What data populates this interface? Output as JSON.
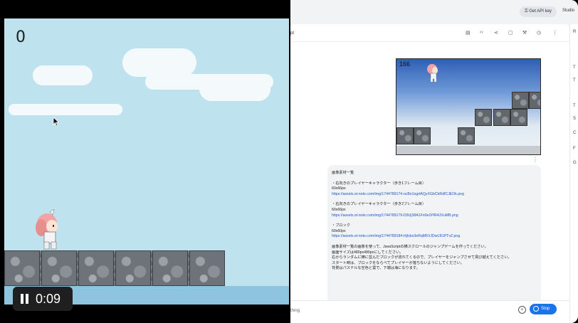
{
  "game": {
    "score": "0",
    "timer": "0:09"
  },
  "studio": {
    "api_key_label": "Get API key",
    "studio_label": "Studio",
    "prompt_title": "pt",
    "side_labels": [
      "R",
      "T",
      "T",
      "T",
      "S",
      "C",
      "F",
      "G"
    ],
    "preview_score": "166",
    "message": {
      "heading": "画像素材一覧",
      "items": [
        {
          "name": "・右向きのプレイヤーキャラクター（歩き1フレーム目）",
          "size": "60x66px",
          "url": "https://assets.st-note.com/img/1744789174-ocBx1ogrtAQyXGbCbRdfCJEOk.png"
        },
        {
          "name": "・右向きのプレイヤーキャラクター（歩き2フレーム目）",
          "size": "60x66px",
          "url": "https://assets.st-note.com/img/1744789179-D9Uj38A1Fn0e1PIR4JXuMB.png"
        },
        {
          "name": "・ブロック",
          "size": "60x60px",
          "url": "https://assets.st-note.com/img/1744789184-HjIsbx3eRqM5VJDwLB1PTvZ.png"
        }
      ],
      "body_lines": [
        "画像素材一覧の画像を使って、JavaScriptの横スクロールのジャンプゲームを作ってください。",
        "画面サイズは480px480pxにしてください。",
        "右からランダムに横に並んだブロックが流れてくるので、プレイヤーをジャンプさせて飛び越えてください。",
        "スタート時は、ブロックをならべてプレイヤーが落ちないようにしてください。",
        "背景はパステルな空色と雲で、下端は海になります。"
      ]
    },
    "input_placeholder": "thing",
    "stop_label": "Stop"
  }
}
